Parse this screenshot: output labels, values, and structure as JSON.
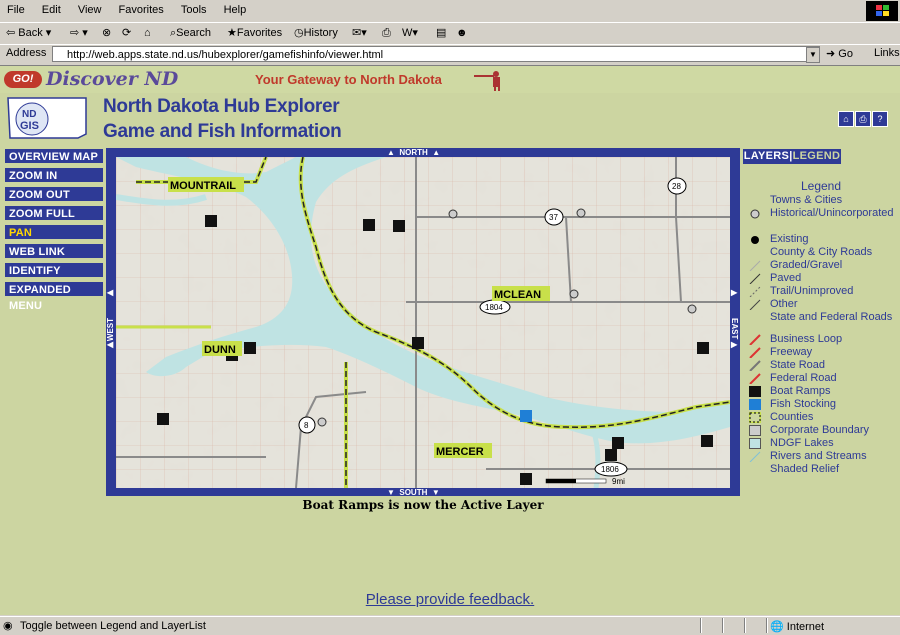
{
  "browser": {
    "menu": [
      "File",
      "Edit",
      "View",
      "Favorites",
      "Tools",
      "Help"
    ],
    "toolbar": {
      "back": "Back",
      "search": "Search",
      "favorites": "Favorites",
      "history": "History"
    },
    "address_label": "Address",
    "url": "http://web.apps.state.nd.us/hubexplorer/gamefishinfo/viewer.html",
    "go": "Go",
    "links": "Links"
  },
  "banner": {
    "go": "GO!",
    "discover": "Discover ND",
    "gateway_prefix": "Your Gateway to",
    "gateway_place": "North Dakota"
  },
  "logo": {
    "text": "ND GIS"
  },
  "title": {
    "line1": "North Dakota Hub Explorer",
    "line2": "Game and Fish Information"
  },
  "nav": [
    {
      "label": "OVERVIEW MAP"
    },
    {
      "label": "ZOOM IN"
    },
    {
      "label": "ZOOM OUT"
    },
    {
      "label": "ZOOM FULL"
    },
    {
      "label": "PAN",
      "active": true
    },
    {
      "label": "WEB LINK"
    },
    {
      "label": "IDENTIFY"
    },
    {
      "label": "EXPANDED MENU"
    }
  ],
  "map": {
    "north": "NORTH",
    "south": "SOUTH",
    "east": "EAST",
    "west": "WEST",
    "counties": [
      "MOUNTRAIL",
      "MCLEAN",
      "DUNN",
      "MERCER"
    ],
    "roads": [
      "28",
      "37",
      "1804",
      "8",
      "1806"
    ],
    "scale": "9mi"
  },
  "active_layer_msg": "Boat Ramps is now the Active Layer",
  "tabs": {
    "layers": "LAYERS",
    "sep": "|",
    "legend": "LEGEND"
  },
  "legend": {
    "title": "Legend",
    "towns_heading": "Towns & Cities",
    "historical": "Historical/Unincorporated",
    "existing": "Existing",
    "county_roads_heading": "County & City Roads",
    "graded": "Graded/Gravel",
    "paved": "Paved",
    "trail": "Trail/Unimproved",
    "other": "Other",
    "state_fed_heading": "State and Federal Roads",
    "business": "Business Loop",
    "freeway": "Freeway",
    "state_road": "State Road",
    "federal_road": "Federal Road",
    "boat_ramps": "Boat Ramps",
    "fish_stocking": "Fish Stocking",
    "counties": "Counties",
    "corporate": "Corporate Boundary",
    "ndgf_lakes": "NDGF Lakes",
    "rivers": "Rivers and Streams",
    "shaded": "Shaded Relief"
  },
  "feedback": "Please provide feedback.",
  "status": {
    "text": "Toggle between Legend and LayerList",
    "zone": "Internet"
  },
  "colors": {
    "page_bg": "#ccd5a1",
    "nav_blue": "#2e3a96",
    "lake": "#bfe3e3",
    "county_line": "#c8e04a"
  }
}
